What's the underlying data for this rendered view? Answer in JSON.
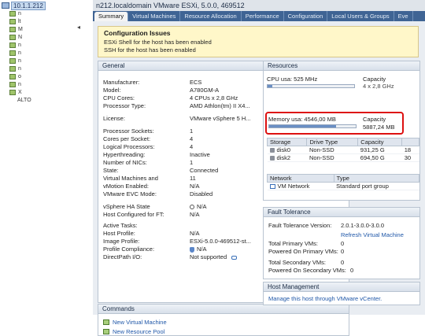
{
  "tree": {
    "host_ip": "10.1.1.212",
    "vm_letters": [
      "n",
      "lt",
      "M",
      "N",
      "n",
      "n",
      "n",
      "n",
      "o",
      "n",
      "X"
    ],
    "vm_trail": "ALTO"
  },
  "window": {
    "title": "n212.localdomain VMware ESXi, 5.0.0, 469512"
  },
  "tabs": [
    "Summary",
    "Virtual Machines",
    "Resource Allocation",
    "Performance",
    "Configuration",
    "Local Users & Groups",
    "Eve"
  ],
  "config_issues": {
    "title": "Configuration Issues",
    "lines": [
      "ESXi Shell for the host has been enabled",
      "SSH for the host has been enabled"
    ]
  },
  "general": {
    "title": "General",
    "rows": [
      {
        "k": "Manufacturer:",
        "v": "ECS"
      },
      {
        "k": "Model:",
        "v": "A780GM-A"
      },
      {
        "k": "CPU Cores:",
        "v": "4 CPUs x 2,8 GHz"
      },
      {
        "k": "Processor Type:",
        "v": "AMD Athlon(tm) II X4..."
      },
      {
        "k": "License:",
        "v": "VMware vSphere 5 H..."
      },
      {
        "k": "Processor Sockets:",
        "v": "1"
      },
      {
        "k": "Cores per Socket:",
        "v": "4"
      },
      {
        "k": "Logical Processors:",
        "v": "4"
      },
      {
        "k": "Hyperthreading:",
        "v": "Inactive"
      },
      {
        "k": "Number of NICs:",
        "v": "1"
      },
      {
        "k": "State:",
        "v": "Connected"
      },
      {
        "k": "Virtual Machines and",
        "v": "11"
      },
      {
        "k": "vMotion Enabled:",
        "v": "N/A"
      },
      {
        "k": "VMware EVC Mode:",
        "v": "Disabled"
      },
      {
        "k": "vSphere HA State",
        "v": "N/A"
      },
      {
        "k": "Host Configured for FT:",
        "v": "N/A"
      },
      {
        "k": "Active Tasks:",
        "v": ""
      },
      {
        "k": "Host Profile:",
        "v": "N/A"
      },
      {
        "k": "Image Profile:",
        "v": "ESXi-5.0.0-469512-st..."
      },
      {
        "k": "Profile Compliance:",
        "v": "N/A"
      },
      {
        "k": "DirectPath I/O:",
        "v": "Not supported"
      }
    ]
  },
  "commands": {
    "title": "Commands",
    "items": [
      "New Virtual Machine",
      "New Resource Pool"
    ]
  },
  "resources": {
    "title": "Resources",
    "cpu_label": "CPU usa: 525 MHz",
    "cpu_capacity_label": "Capacity",
    "cpu_capacity_value": "4 x 2,8 GHz",
    "cpu_fraction": 0.05,
    "mem_label": "Memory usa: 4546,00 MB",
    "mem_capacity_label": "Capacity",
    "mem_capacity_value": "5887,24 MB",
    "mem_fraction": 0.77,
    "storage_headers": [
      "Storage",
      "Drive Type",
      "Capacity"
    ],
    "storage_rows": [
      {
        "name": "disk0",
        "type": "Non-SSD",
        "cap": "931,25 G",
        "extra": "18"
      },
      {
        "name": "disk2",
        "type": "Non-SSD",
        "cap": "694,50 G",
        "extra": "30"
      }
    ],
    "network_headers": [
      "Network",
      "Type"
    ],
    "network_rows": [
      {
        "name": "VM Network",
        "type": "Standard port group"
      }
    ]
  },
  "fault_tolerance": {
    "title": "Fault Tolerance",
    "version_label": "Fault Tolerance Version:",
    "version_value": "2.0.1-3.0.0-3.0.0",
    "refresh_link": "Refresh Virtual Machine",
    "rows": [
      {
        "k": "Total Primary VMs:",
        "v": "0"
      },
      {
        "k": "Powered On Primary VMs:",
        "v": "0"
      },
      {
        "k": "Total Secondary VMs:",
        "v": "0"
      },
      {
        "k": "Powered On Secondary VMs:",
        "v": "0"
      }
    ]
  },
  "host_management": {
    "title": "Host Management",
    "link": "Manage this host through VMware vCenter."
  }
}
